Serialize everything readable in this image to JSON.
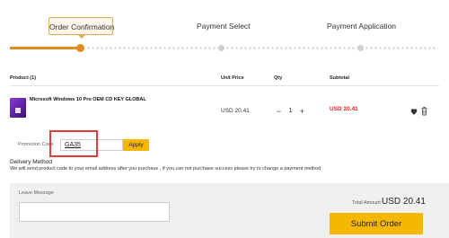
{
  "steps": {
    "items": [
      {
        "label": "Order Confirmation",
        "state": "active"
      },
      {
        "label": "Payment Select",
        "state": "pending"
      },
      {
        "label": "Payment Application",
        "state": "pending"
      }
    ],
    "active_color": "#e38b1f"
  },
  "table": {
    "headers": {
      "product": "Product (1)",
      "unit_price": "Unit Price",
      "qty": "Qty",
      "subtotal": "Subtotal"
    },
    "row": {
      "name": "Microsoft Windows 10 Pro OEM CD KEY GLOBAL",
      "unit_price": "USD 20.41",
      "qty": "1",
      "qty_minus": "−",
      "qty_plus": "+",
      "subtotal": "USD 20.41",
      "subtotal_color": "#e0241b",
      "icons": [
        "heart-icon",
        "trash-icon"
      ]
    }
  },
  "promo": {
    "label": "Promotion Code",
    "value": "GA35",
    "apply_label": "Apply"
  },
  "delivery": {
    "title": "Delivery Method",
    "text": "We will send product code to your email address after you purchase , if you can not purchase success please try to change a payment method"
  },
  "footer": {
    "leave_message_label": "Leave Message",
    "leave_message_value": "",
    "total_label": "Total Amount:",
    "total_value": "USD 20.41",
    "submit_label": "Submit Order",
    "button_color": "#f5b700"
  }
}
